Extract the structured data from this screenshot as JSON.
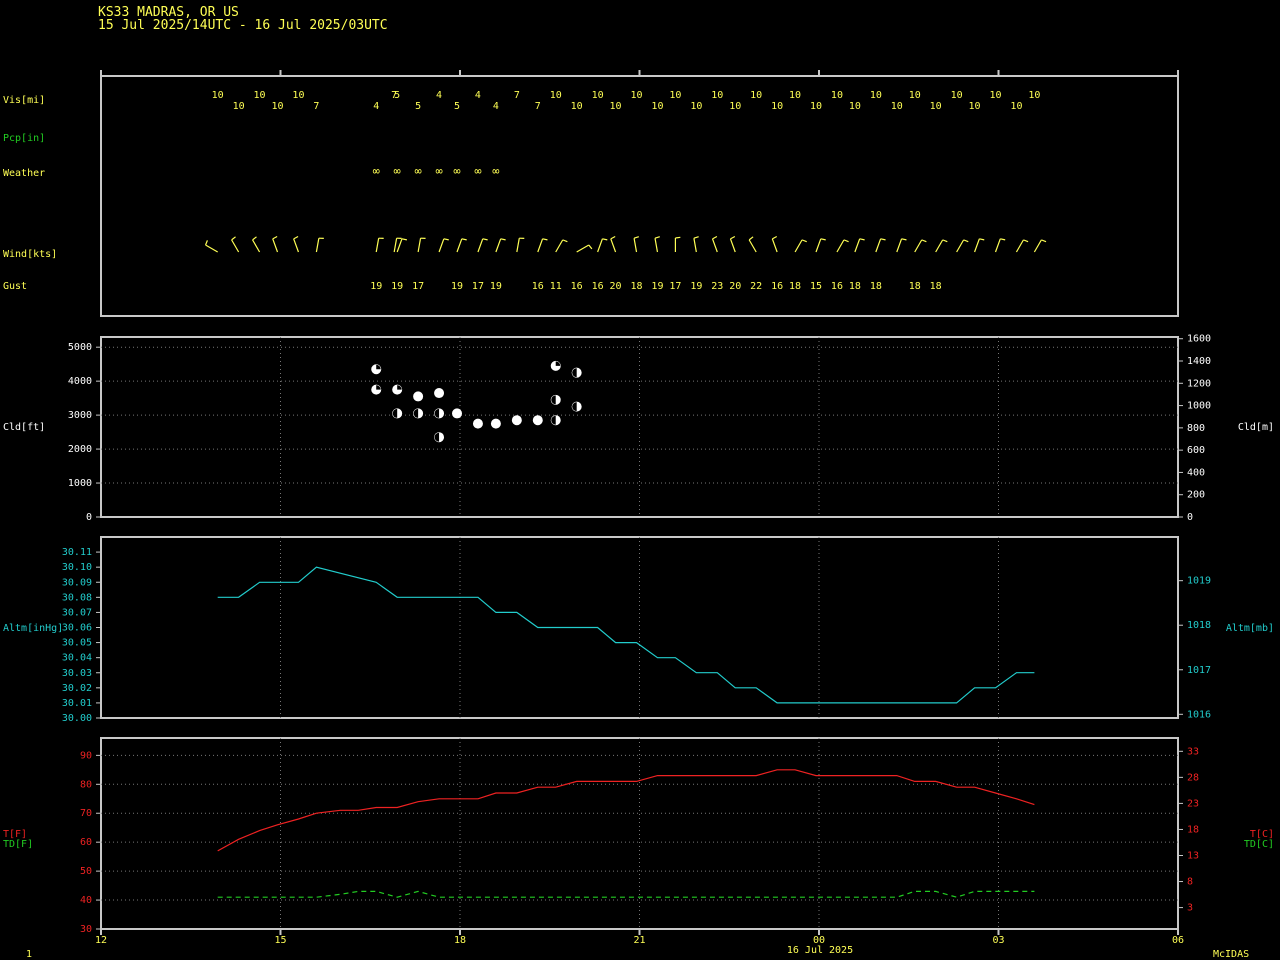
{
  "header": {
    "station": "KS33  MADRAS, OR US",
    "period": "15 Jul 2025/14UTC - 16 Jul 2025/03UTC"
  },
  "footer": {
    "left_number": "1",
    "date_label": "16 Jul 2025",
    "brand": "McIDAS"
  },
  "colors": {
    "background": "#000000",
    "frame": "#c8c8c8",
    "yellow": "#ffff55",
    "green": "#22cc22",
    "cyan": "#22cccc",
    "red": "#ee2222",
    "white": "#ffffff"
  },
  "chart_data": [
    {
      "type": "table",
      "panel": "observations",
      "row_labels": {
        "vis": "Vis[mi]",
        "pcp": "Pcp[in]",
        "weather": "Weather",
        "wind": "Wind[kts]",
        "gust": "Gust"
      },
      "x_range_hours": [
        12,
        30
      ],
      "observations": [
        {
          "t": 13.95,
          "vis": "10",
          "wx": "",
          "wind_dir": 300,
          "gust": ""
        },
        {
          "t": 14.3,
          "vis": "10",
          "wx": "",
          "wind_dir": 330,
          "gust": ""
        },
        {
          "t": 14.65,
          "vis": "10",
          "wx": "",
          "wind_dir": 330,
          "gust": ""
        },
        {
          "t": 14.95,
          "vis": "10",
          "wx": "",
          "wind_dir": 340,
          "gust": ""
        },
        {
          "t": 15.3,
          "vis": "10",
          "wx": "",
          "wind_dir": 340,
          "gust": ""
        },
        {
          "t": 15.6,
          "vis": "7",
          "wx": "",
          "wind_dir": 10,
          "gust": ""
        },
        {
          "t": 16.9,
          "vis": "7",
          "wx": "",
          "wind_dir": 10,
          "gust": ""
        },
        {
          "t": 16.6,
          "vis": "4",
          "wx": "haze",
          "wind_dir": 10,
          "gust": "19"
        },
        {
          "t": 16.95,
          "vis": "5",
          "wx": "haze",
          "wind_dir": 20,
          "gust": "19"
        },
        {
          "t": 17.3,
          "vis": "5",
          "wx": "haze",
          "wind_dir": 10,
          "gust": "17"
        },
        {
          "t": 17.65,
          "vis": "4",
          "wx": "haze",
          "wind_dir": 20,
          "gust": ""
        },
        {
          "t": 17.95,
          "vis": "5",
          "wx": "haze",
          "wind_dir": 20,
          "gust": "19"
        },
        {
          "t": 18.3,
          "vis": "4",
          "wx": "haze",
          "wind_dir": 20,
          "gust": "17"
        },
        {
          "t": 18.6,
          "vis": "4",
          "wx": "haze",
          "wind_dir": 20,
          "gust": "19"
        },
        {
          "t": 18.95,
          "vis": "7",
          "wx": "",
          "wind_dir": 10,
          "gust": ""
        },
        {
          "t": 19.3,
          "vis": "7",
          "wx": "",
          "wind_dir": 20,
          "gust": "16"
        },
        {
          "t": 19.6,
          "vis": "10",
          "wx": "",
          "wind_dir": 30,
          "gust": "11"
        },
        {
          "t": 19.95,
          "vis": "10",
          "wx": "",
          "wind_dir": 60,
          "gust": "16"
        },
        {
          "t": 20.3,
          "vis": "10",
          "wx": "",
          "wind_dir": 20,
          "gust": "16"
        },
        {
          "t": 20.6,
          "vis": "10",
          "wx": "",
          "wind_dir": 340,
          "gust": "20"
        },
        {
          "t": 20.95,
          "vis": "10",
          "wx": "",
          "wind_dir": 350,
          "gust": "18"
        },
        {
          "t": 21.3,
          "vis": "10",
          "wx": "",
          "wind_dir": 350,
          "gust": "19"
        },
        {
          "t": 21.6,
          "vis": "10",
          "wx": "",
          "wind_dir": 0,
          "gust": "17"
        },
        {
          "t": 21.95,
          "vis": "10",
          "wx": "",
          "wind_dir": 350,
          "gust": "19"
        },
        {
          "t": 22.3,
          "vis": "10",
          "wx": "",
          "wind_dir": 340,
          "gust": "23"
        },
        {
          "t": 22.6,
          "vis": "10",
          "wx": "",
          "wind_dir": 340,
          "gust": "20"
        },
        {
          "t": 22.95,
          "vis": "10",
          "wx": "",
          "wind_dir": 330,
          "gust": "22"
        },
        {
          "t": 23.3,
          "vis": "10",
          "wx": "",
          "wind_dir": 340,
          "gust": "16"
        },
        {
          "t": 23.6,
          "vis": "10",
          "wx": "",
          "wind_dir": 30,
          "gust": "18"
        },
        {
          "t": 23.95,
          "vis": "10",
          "wx": "",
          "wind_dir": 20,
          "gust": "15"
        },
        {
          "t": 24.3,
          "vis": "10",
          "wx": "",
          "wind_dir": 30,
          "gust": "16"
        },
        {
          "t": 24.6,
          "vis": "10",
          "wx": "",
          "wind_dir": 20,
          "gust": "18"
        },
        {
          "t": 24.95,
          "vis": "10",
          "wx": "",
          "wind_dir": 20,
          "gust": "18"
        },
        {
          "t": 25.3,
          "vis": "10",
          "wx": "",
          "wind_dir": 20,
          "gust": ""
        },
        {
          "t": 25.6,
          "vis": "10",
          "wx": "",
          "wind_dir": 30,
          "gust": "18"
        },
        {
          "t": 25.95,
          "vis": "10",
          "wx": "",
          "wind_dir": 30,
          "gust": "18"
        },
        {
          "t": 26.3,
          "vis": "10",
          "wx": "",
          "wind_dir": 30,
          "gust": ""
        },
        {
          "t": 26.6,
          "vis": "10",
          "wx": "",
          "wind_dir": 20,
          "gust": ""
        },
        {
          "t": 26.95,
          "vis": "10",
          "wx": "",
          "wind_dir": 20,
          "gust": ""
        },
        {
          "t": 27.3,
          "vis": "10",
          "wx": "",
          "wind_dir": 30,
          "gust": ""
        },
        {
          "t": 27.6,
          "vis": "10",
          "wx": "",
          "wind_dir": 30,
          "gust": ""
        }
      ]
    },
    {
      "type": "scatter",
      "panel": "cloud",
      "ylabel_left": "Cld[ft]",
      "ylabel_right": "Cld[m]",
      "ylim_ft": [
        0,
        5300
      ],
      "yticks_ft": [
        0,
        1000,
        2000,
        3000,
        4000,
        5000
      ],
      "yticks_m": [
        0,
        200,
        400,
        600,
        800,
        1000,
        1200,
        1400,
        1600
      ],
      "points": [
        {
          "t": 16.6,
          "ft": 4350,
          "cover": "bkn"
        },
        {
          "t": 16.6,
          "ft": 3750,
          "cover": "bkn"
        },
        {
          "t": 16.95,
          "ft": 3750,
          "cover": "bkn"
        },
        {
          "t": 16.95,
          "ft": 3050,
          "cover": "sct"
        },
        {
          "t": 17.3,
          "ft": 3550,
          "cover": "ovc"
        },
        {
          "t": 17.3,
          "ft": 3050,
          "cover": "sct"
        },
        {
          "t": 17.65,
          "ft": 3650,
          "cover": "ovc"
        },
        {
          "t": 17.65,
          "ft": 3050,
          "cover": "sct"
        },
        {
          "t": 17.65,
          "ft": 2350,
          "cover": "sct"
        },
        {
          "t": 17.95,
          "ft": 3050,
          "cover": "ovc"
        },
        {
          "t": 18.3,
          "ft": 2750,
          "cover": "ovc"
        },
        {
          "t": 18.6,
          "ft": 2750,
          "cover": "ovc"
        },
        {
          "t": 18.95,
          "ft": 2850,
          "cover": "ovc"
        },
        {
          "t": 19.3,
          "ft": 2850,
          "cover": "ovc"
        },
        {
          "t": 19.6,
          "ft": 4450,
          "cover": "bkn"
        },
        {
          "t": 19.6,
          "ft": 3450,
          "cover": "sct"
        },
        {
          "t": 19.6,
          "ft": 2850,
          "cover": "sct"
        },
        {
          "t": 19.95,
          "ft": 4250,
          "cover": "sct"
        },
        {
          "t": 19.95,
          "ft": 3250,
          "cover": "sct"
        }
      ]
    },
    {
      "type": "line",
      "panel": "altimeter",
      "ylabel_left": "Altm[inHg]",
      "ylabel_right": "Altm[mb]",
      "ylim": [
        30.0,
        30.12
      ],
      "yticks": [
        "30.00",
        "30.01",
        "30.02",
        "30.03",
        "30.04",
        "30.05",
        "30.06",
        "30.07",
        "30.08",
        "30.09",
        "30.10",
        "30.11"
      ],
      "yticks_right": [
        "1016",
        "1017",
        "1018",
        "1019"
      ],
      "x": [
        13.95,
        14.3,
        14.65,
        14.95,
        15.3,
        15.6,
        16.6,
        16.95,
        17.3,
        17.65,
        17.95,
        18.3,
        18.6,
        18.95,
        19.3,
        19.6,
        19.95,
        20.3,
        20.6,
        20.95,
        21.3,
        21.6,
        21.95,
        22.3,
        22.6,
        22.95,
        23.3,
        23.6,
        23.95,
        24.3,
        24.6,
        24.95,
        25.3,
        25.6,
        25.95,
        26.3,
        26.6,
        26.95,
        27.3,
        27.6
      ],
      "values": [
        30.08,
        30.08,
        30.09,
        30.09,
        30.09,
        30.1,
        30.09,
        30.08,
        30.08,
        30.08,
        30.08,
        30.08,
        30.07,
        30.07,
        30.06,
        30.06,
        30.06,
        30.06,
        30.05,
        30.05,
        30.04,
        30.04,
        30.03,
        30.03,
        30.02,
        30.02,
        30.01,
        30.01,
        30.01,
        30.01,
        30.01,
        30.01,
        30.01,
        30.01,
        30.01,
        30.01,
        30.02,
        30.02,
        30.03,
        30.03
      ]
    },
    {
      "type": "line",
      "panel": "temperature",
      "ylabel_left_t": "T[F]",
      "ylabel_left_td": "TD[F]",
      "ylabel_right_t": "T[C]",
      "ylabel_right_td": "TD[C]",
      "ylim": [
        30,
        96
      ],
      "yticks": [
        "30",
        "40",
        "50",
        "60",
        "70",
        "80",
        "90"
      ],
      "yticks_right": [
        "3",
        "8",
        "13",
        "18",
        "23",
        "28",
        "33"
      ],
      "x": [
        13.95,
        14.3,
        14.65,
        14.95,
        15.3,
        15.6,
        16.0,
        16.3,
        16.6,
        16.95,
        17.3,
        17.65,
        17.95,
        18.3,
        18.6,
        18.95,
        19.3,
        19.6,
        19.95,
        20.3,
        20.6,
        20.95,
        21.3,
        21.6,
        21.95,
        22.3,
        22.6,
        22.95,
        23.3,
        23.6,
        23.95,
        24.3,
        24.6,
        24.95,
        25.3,
        25.6,
        25.95,
        26.3,
        26.6,
        26.95,
        27.3,
        27.6
      ],
      "series": [
        {
          "name": "T[F]",
          "color": "#ee2222",
          "dash": false,
          "values": [
            57,
            61,
            64,
            66,
            68,
            70,
            71,
            71,
            72,
            72,
            74,
            75,
            75,
            75,
            77,
            77,
            79,
            79,
            81,
            81,
            81,
            81,
            83,
            83,
            83,
            83,
            83,
            83,
            85,
            85,
            83,
            83,
            83,
            83,
            83,
            81,
            81,
            79,
            79,
            77,
            75,
            73
          ]
        },
        {
          "name": "TD[F]",
          "color": "#22cc22",
          "dash": true,
          "values": [
            41,
            41,
            41,
            41,
            41,
            41,
            42,
            43,
            43,
            41,
            43,
            41,
            41,
            41,
            41,
            41,
            41,
            41,
            41,
            41,
            41,
            41,
            41,
            41,
            41,
            41,
            41,
            41,
            41,
            41,
            41,
            41,
            41,
            41,
            41,
            43,
            43,
            41,
            43,
            43,
            43,
            43
          ]
        }
      ]
    }
  ],
  "x_axis": {
    "tick_hours": [
      12,
      15,
      18,
      21,
      24,
      27,
      30
    ],
    "tick_labels": [
      "12",
      "15",
      "18",
      "21",
      "00",
      "03",
      "06"
    ]
  }
}
